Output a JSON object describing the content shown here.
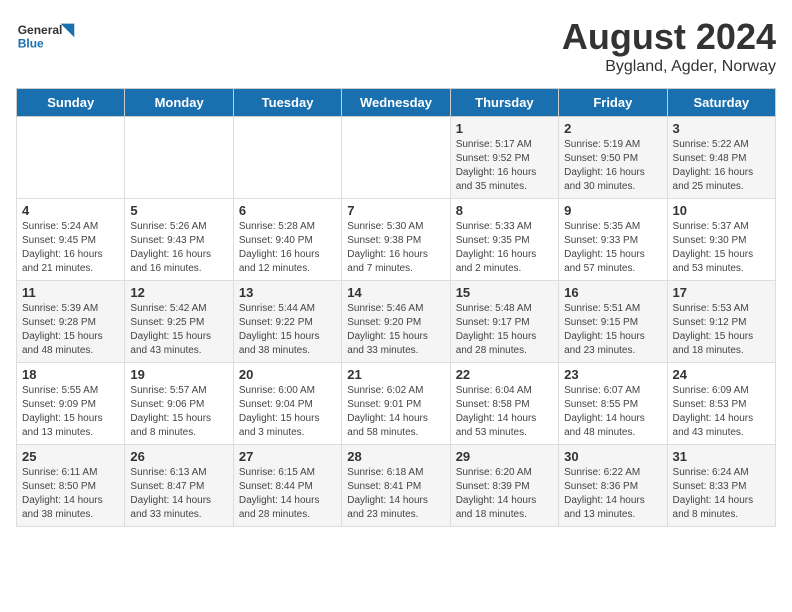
{
  "header": {
    "logo_general": "General",
    "logo_blue": "Blue",
    "title": "August 2024",
    "subtitle": "Bygland, Agder, Norway"
  },
  "weekdays": [
    "Sunday",
    "Monday",
    "Tuesday",
    "Wednesday",
    "Thursday",
    "Friday",
    "Saturday"
  ],
  "weeks": [
    [
      {
        "day": "",
        "sunrise": "",
        "sunset": "",
        "daylight": ""
      },
      {
        "day": "",
        "sunrise": "",
        "sunset": "",
        "daylight": ""
      },
      {
        "day": "",
        "sunrise": "",
        "sunset": "",
        "daylight": ""
      },
      {
        "day": "",
        "sunrise": "",
        "sunset": "",
        "daylight": ""
      },
      {
        "day": "1",
        "sunrise": "Sunrise: 5:17 AM",
        "sunset": "Sunset: 9:52 PM",
        "daylight": "Daylight: 16 hours and 35 minutes."
      },
      {
        "day": "2",
        "sunrise": "Sunrise: 5:19 AM",
        "sunset": "Sunset: 9:50 PM",
        "daylight": "Daylight: 16 hours and 30 minutes."
      },
      {
        "day": "3",
        "sunrise": "Sunrise: 5:22 AM",
        "sunset": "Sunset: 9:48 PM",
        "daylight": "Daylight: 16 hours and 25 minutes."
      }
    ],
    [
      {
        "day": "4",
        "sunrise": "Sunrise: 5:24 AM",
        "sunset": "Sunset: 9:45 PM",
        "daylight": "Daylight: 16 hours and 21 minutes."
      },
      {
        "day": "5",
        "sunrise": "Sunrise: 5:26 AM",
        "sunset": "Sunset: 9:43 PM",
        "daylight": "Daylight: 16 hours and 16 minutes."
      },
      {
        "day": "6",
        "sunrise": "Sunrise: 5:28 AM",
        "sunset": "Sunset: 9:40 PM",
        "daylight": "Daylight: 16 hours and 12 minutes."
      },
      {
        "day": "7",
        "sunrise": "Sunrise: 5:30 AM",
        "sunset": "Sunset: 9:38 PM",
        "daylight": "Daylight: 16 hours and 7 minutes."
      },
      {
        "day": "8",
        "sunrise": "Sunrise: 5:33 AM",
        "sunset": "Sunset: 9:35 PM",
        "daylight": "Daylight: 16 hours and 2 minutes."
      },
      {
        "day": "9",
        "sunrise": "Sunrise: 5:35 AM",
        "sunset": "Sunset: 9:33 PM",
        "daylight": "Daylight: 15 hours and 57 minutes."
      },
      {
        "day": "10",
        "sunrise": "Sunrise: 5:37 AM",
        "sunset": "Sunset: 9:30 PM",
        "daylight": "Daylight: 15 hours and 53 minutes."
      }
    ],
    [
      {
        "day": "11",
        "sunrise": "Sunrise: 5:39 AM",
        "sunset": "Sunset: 9:28 PM",
        "daylight": "Daylight: 15 hours and 48 minutes."
      },
      {
        "day": "12",
        "sunrise": "Sunrise: 5:42 AM",
        "sunset": "Sunset: 9:25 PM",
        "daylight": "Daylight: 15 hours and 43 minutes."
      },
      {
        "day": "13",
        "sunrise": "Sunrise: 5:44 AM",
        "sunset": "Sunset: 9:22 PM",
        "daylight": "Daylight: 15 hours and 38 minutes."
      },
      {
        "day": "14",
        "sunrise": "Sunrise: 5:46 AM",
        "sunset": "Sunset: 9:20 PM",
        "daylight": "Daylight: 15 hours and 33 minutes."
      },
      {
        "day": "15",
        "sunrise": "Sunrise: 5:48 AM",
        "sunset": "Sunset: 9:17 PM",
        "daylight": "Daylight: 15 hours and 28 minutes."
      },
      {
        "day": "16",
        "sunrise": "Sunrise: 5:51 AM",
        "sunset": "Sunset: 9:15 PM",
        "daylight": "Daylight: 15 hours and 23 minutes."
      },
      {
        "day": "17",
        "sunrise": "Sunrise: 5:53 AM",
        "sunset": "Sunset: 9:12 PM",
        "daylight": "Daylight: 15 hours and 18 minutes."
      }
    ],
    [
      {
        "day": "18",
        "sunrise": "Sunrise: 5:55 AM",
        "sunset": "Sunset: 9:09 PM",
        "daylight": "Daylight: 15 hours and 13 minutes."
      },
      {
        "day": "19",
        "sunrise": "Sunrise: 5:57 AM",
        "sunset": "Sunset: 9:06 PM",
        "daylight": "Daylight: 15 hours and 8 minutes."
      },
      {
        "day": "20",
        "sunrise": "Sunrise: 6:00 AM",
        "sunset": "Sunset: 9:04 PM",
        "daylight": "Daylight: 15 hours and 3 minutes."
      },
      {
        "day": "21",
        "sunrise": "Sunrise: 6:02 AM",
        "sunset": "Sunset: 9:01 PM",
        "daylight": "Daylight: 14 hours and 58 minutes."
      },
      {
        "day": "22",
        "sunrise": "Sunrise: 6:04 AM",
        "sunset": "Sunset: 8:58 PM",
        "daylight": "Daylight: 14 hours and 53 minutes."
      },
      {
        "day": "23",
        "sunrise": "Sunrise: 6:07 AM",
        "sunset": "Sunset: 8:55 PM",
        "daylight": "Daylight: 14 hours and 48 minutes."
      },
      {
        "day": "24",
        "sunrise": "Sunrise: 6:09 AM",
        "sunset": "Sunset: 8:53 PM",
        "daylight": "Daylight: 14 hours and 43 minutes."
      }
    ],
    [
      {
        "day": "25",
        "sunrise": "Sunrise: 6:11 AM",
        "sunset": "Sunset: 8:50 PM",
        "daylight": "Daylight: 14 hours and 38 minutes."
      },
      {
        "day": "26",
        "sunrise": "Sunrise: 6:13 AM",
        "sunset": "Sunset: 8:47 PM",
        "daylight": "Daylight: 14 hours and 33 minutes."
      },
      {
        "day": "27",
        "sunrise": "Sunrise: 6:15 AM",
        "sunset": "Sunset: 8:44 PM",
        "daylight": "Daylight: 14 hours and 28 minutes."
      },
      {
        "day": "28",
        "sunrise": "Sunrise: 6:18 AM",
        "sunset": "Sunset: 8:41 PM",
        "daylight": "Daylight: 14 hours and 23 minutes."
      },
      {
        "day": "29",
        "sunrise": "Sunrise: 6:20 AM",
        "sunset": "Sunset: 8:39 PM",
        "daylight": "Daylight: 14 hours and 18 minutes."
      },
      {
        "day": "30",
        "sunrise": "Sunrise: 6:22 AM",
        "sunset": "Sunset: 8:36 PM",
        "daylight": "Daylight: 14 hours and 13 minutes."
      },
      {
        "day": "31",
        "sunrise": "Sunrise: 6:24 AM",
        "sunset": "Sunset: 8:33 PM",
        "daylight": "Daylight: 14 hours and 8 minutes."
      }
    ]
  ]
}
